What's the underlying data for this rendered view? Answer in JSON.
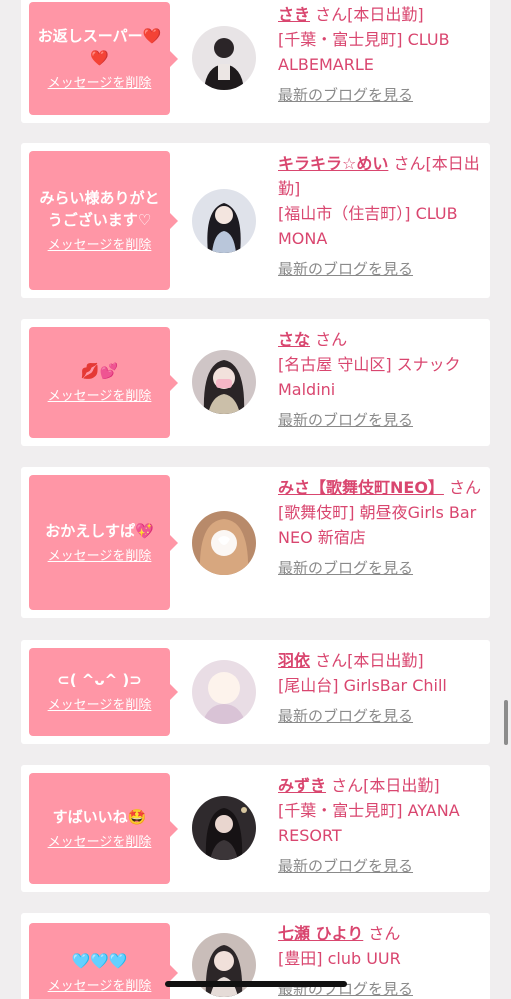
{
  "delete_label": "メッセージを削除",
  "blog_label": "最新のブログを見る",
  "items": [
    {
      "message": "お返しスーパー❤️❤️",
      "name": "さき",
      "suffix": "さん[本日出勤]",
      "shop": "[千葉・富士見町] CLUB ALBEMARLE",
      "avatar_color": "#e8e4e6"
    },
    {
      "message": "みらい様ありがとうございます♡",
      "name": "キラキラ☆めい",
      "suffix": "さん[本日出勤]",
      "shop": "[福山市（住吉町）] CLUB MONA",
      "avatar_color": "#d9dde6"
    },
    {
      "message": "💋💕",
      "name": "さな",
      "suffix": "さん",
      "shop": "[名古屋 守山区] スナック Maldini",
      "avatar_color": "#cfc5c6"
    },
    {
      "message": "おかえしすぱ💖",
      "name": "みさ【歌舞伎町NEO】",
      "suffix": "さん",
      "shop": "[歌舞伎町] 朝昼夜Girls Bar NEO 新宿店",
      "avatar_color": "#c89a7a"
    },
    {
      "message": "⊂( ^ᴗ^ )⊃",
      "name": "羽依",
      "suffix": "さん[本日出勤]",
      "shop": "[尾山台] GirlsBar Chill",
      "avatar_color": "#e7d8e2"
    },
    {
      "message": "すばいいね🤩",
      "name": "みずき",
      "suffix": "さん[本日出勤]",
      "shop": "[千葉・富士見町] AYANA RESORT",
      "avatar_color": "#4a4448"
    },
    {
      "message": "🩵🩵🩵",
      "name": "七瀬 ひより",
      "suffix": "さん",
      "shop": "[豊田] club UUR",
      "avatar_color": "#c5b8b5"
    }
  ]
}
